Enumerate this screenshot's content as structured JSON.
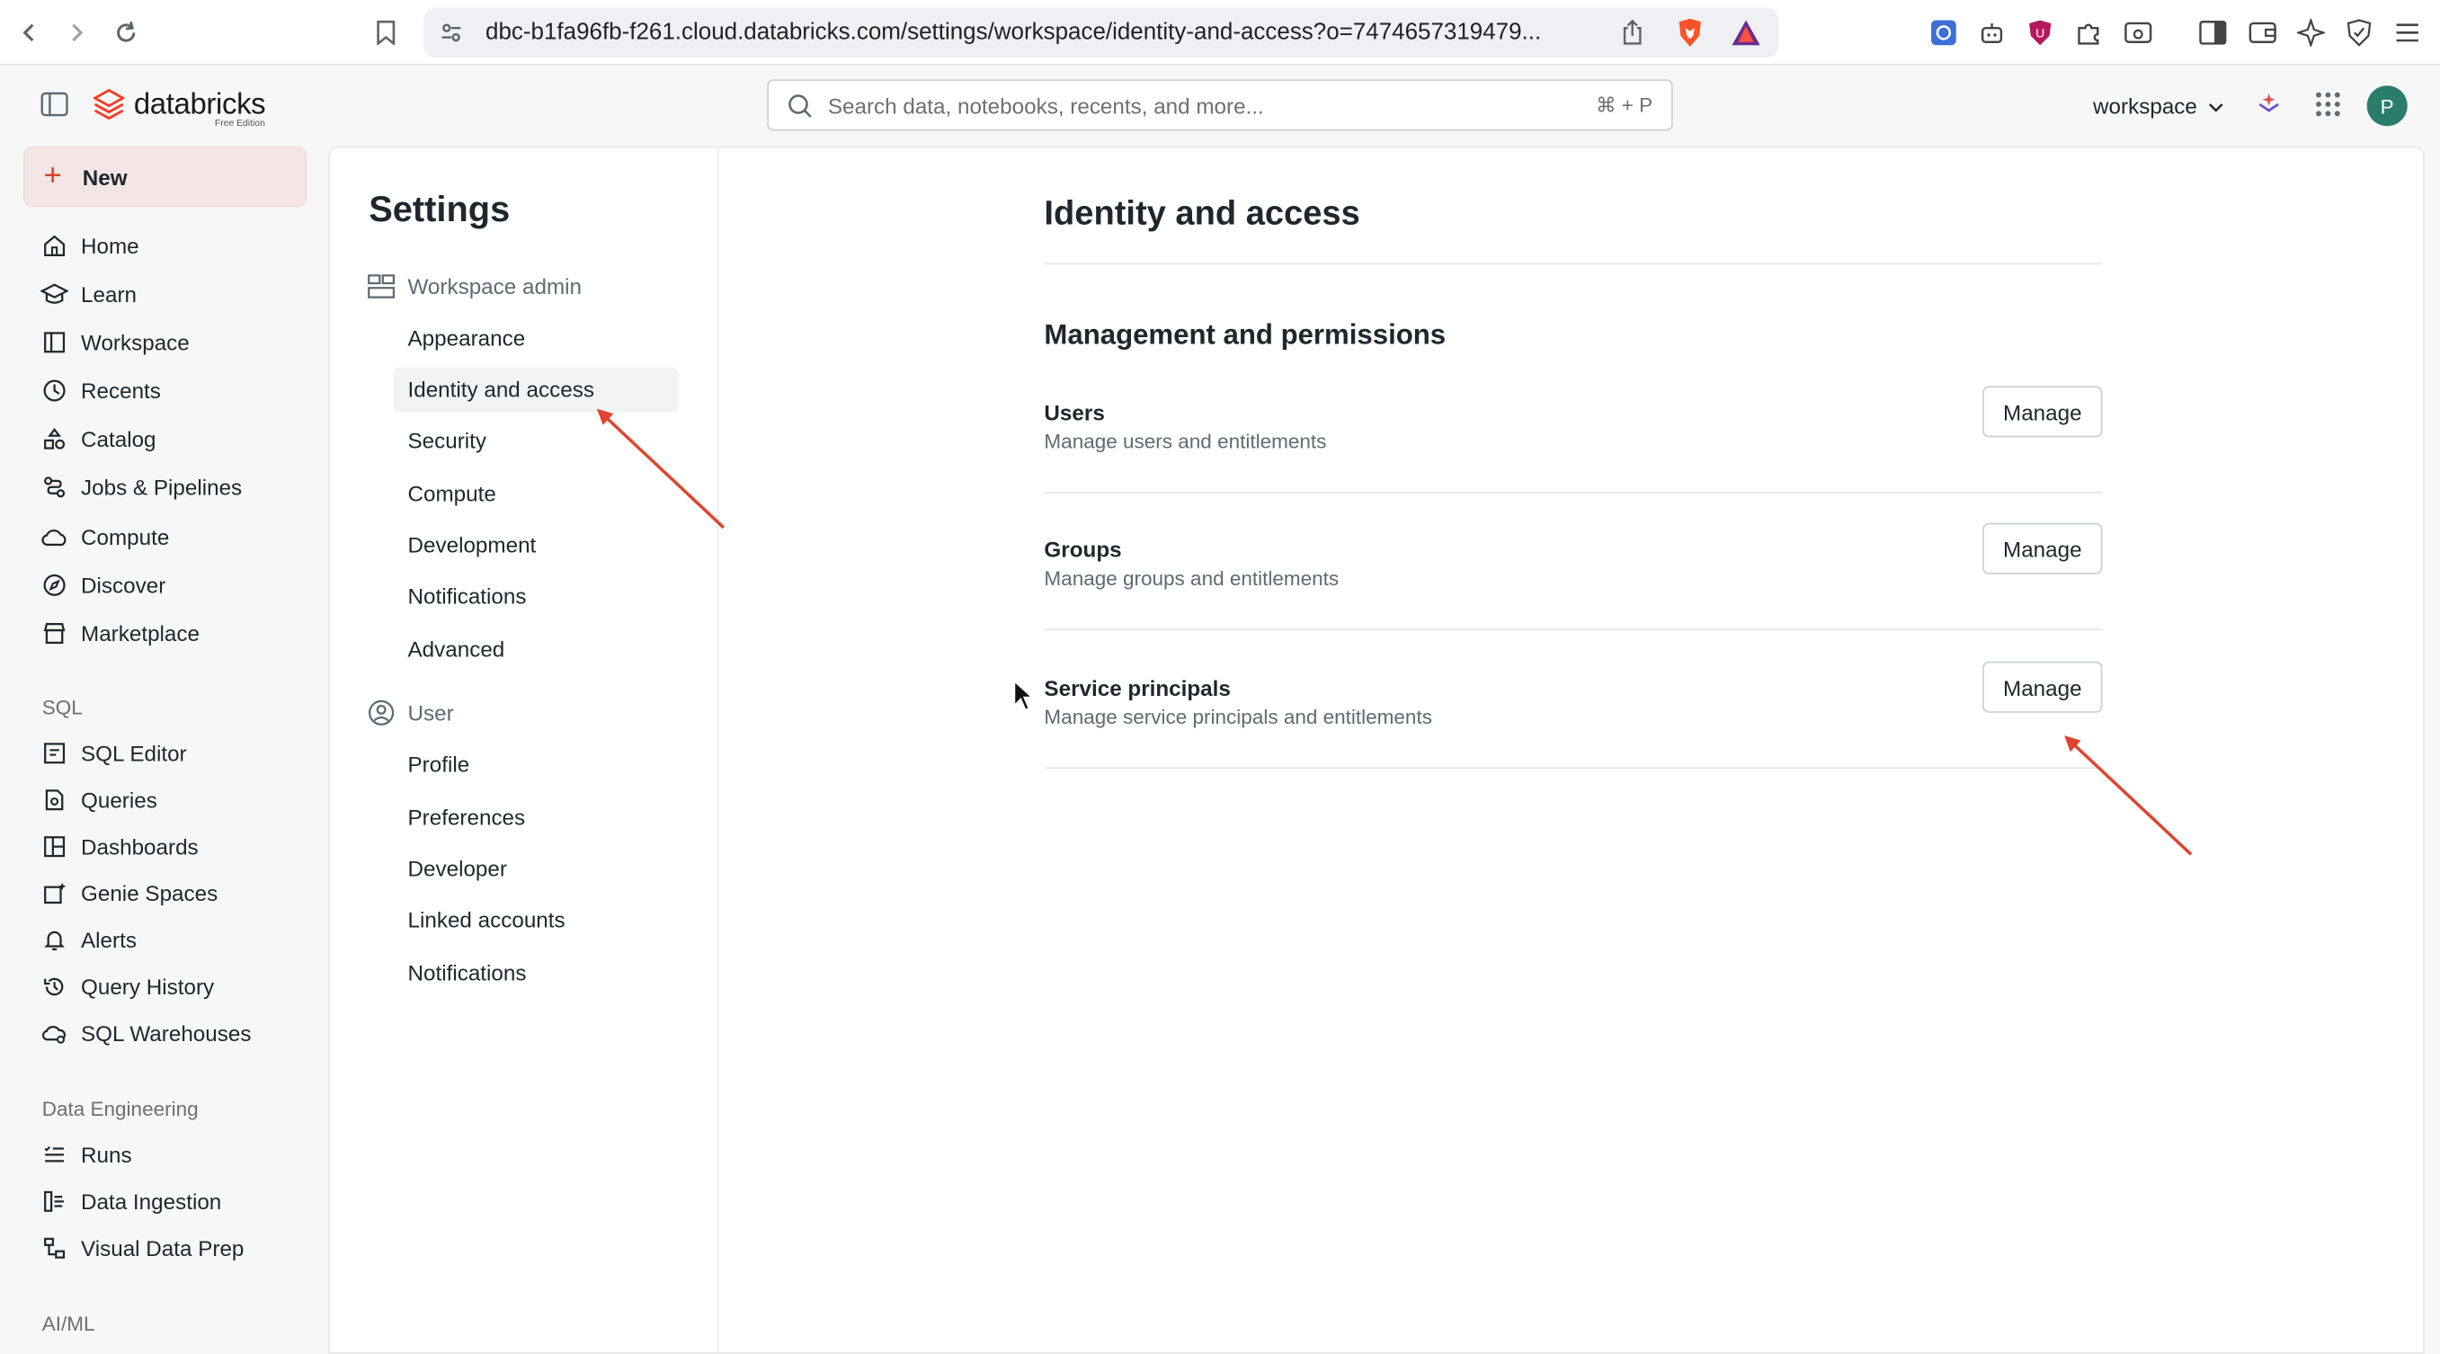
{
  "browser": {
    "url": "dbc-b1fa96fb-f261.cloud.databricks.com/settings/workspace/identity-and-access?o=7474657319479..."
  },
  "app": {
    "logo_text": "databricks",
    "logo_sub": "Free Edition",
    "search_placeholder": "Search data, notebooks, recents, and more...",
    "search_shortcut": "⌘ + P",
    "workspace_label": "workspace",
    "avatar_initial": "P",
    "brand_color": "#ff3621"
  },
  "leftnav": {
    "new_label": "New",
    "items": [
      {
        "label": "Home",
        "icon": "home-icon"
      },
      {
        "label": "Learn",
        "icon": "graduation-cap-icon"
      },
      {
        "label": "Workspace",
        "icon": "workspace-icon"
      },
      {
        "label": "Recents",
        "icon": "clock-icon"
      },
      {
        "label": "Catalog",
        "icon": "catalog-icon"
      },
      {
        "label": "Jobs & Pipelines",
        "icon": "workflow-icon"
      },
      {
        "label": "Compute",
        "icon": "cloud-icon"
      },
      {
        "label": "Discover",
        "icon": "compass-icon"
      },
      {
        "label": "Marketplace",
        "icon": "shop-icon"
      }
    ],
    "sql_section": "SQL",
    "sql_items": [
      {
        "label": "SQL Editor",
        "icon": "sql-editor-icon"
      },
      {
        "label": "Queries",
        "icon": "query-icon"
      },
      {
        "label": "Dashboards",
        "icon": "dashboard-icon"
      },
      {
        "label": "Genie Spaces",
        "icon": "genie-icon"
      },
      {
        "label": "Alerts",
        "icon": "bell-icon"
      },
      {
        "label": "Query History",
        "icon": "history-icon"
      },
      {
        "label": "SQL Warehouses",
        "icon": "warehouse-icon"
      }
    ],
    "de_section": "Data Engineering",
    "de_items": [
      {
        "label": "Runs",
        "icon": "list-icon"
      },
      {
        "label": "Data Ingestion",
        "icon": "ingestion-icon"
      },
      {
        "label": "Visual Data Prep",
        "icon": "data-prep-icon"
      }
    ],
    "aiml_section": "AI/ML"
  },
  "settings": {
    "title": "Settings",
    "workspace_admin": "Workspace admin",
    "admin_items": [
      "Appearance",
      "Identity and access",
      "Security",
      "Compute",
      "Development",
      "Notifications",
      "Advanced"
    ],
    "user_group": "User",
    "user_items": [
      "Profile",
      "Preferences",
      "Developer",
      "Linked accounts",
      "Notifications"
    ]
  },
  "content": {
    "page_title": "Identity and access",
    "section_title": "Management and permissions",
    "rows": [
      {
        "name": "Users",
        "desc": "Manage users and entitlements",
        "button": "Manage"
      },
      {
        "name": "Groups",
        "desc": "Manage groups and entitlements",
        "button": "Manage"
      },
      {
        "name": "Service principals",
        "desc": "Manage service principals and entitlements",
        "button": "Manage"
      }
    ]
  },
  "annotation_color": "#e0432f"
}
